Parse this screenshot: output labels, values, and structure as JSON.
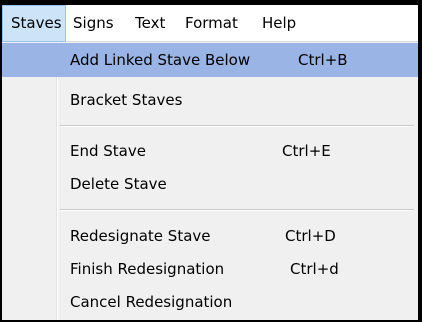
{
  "menubar": {
    "items": [
      {
        "label": "Staves",
        "active": true
      },
      {
        "label": "Signs"
      },
      {
        "label": "Text"
      },
      {
        "label": "Format"
      },
      {
        "label": "Help"
      }
    ]
  },
  "dropdown": {
    "items": [
      {
        "label": "Add Linked Stave Below",
        "shortcut": "Ctrl+B",
        "highlighted": true
      },
      {
        "label": "Bracket Staves",
        "shortcut": ""
      },
      {
        "label": "End Stave",
        "shortcut": "Ctrl+E"
      },
      {
        "label": "Delete Stave",
        "shortcut": ""
      },
      {
        "label": "Redesignate Stave",
        "shortcut": "Ctrl+D"
      },
      {
        "label": "Finish Redesignation",
        "shortcut": "Ctrl+d"
      },
      {
        "label": "Cancel Redesignation",
        "shortcut": ""
      }
    ]
  },
  "colors": {
    "active_menu_bg": "#cde3f8",
    "highlight_bg": "#99b4e5",
    "dropdown_bg": "#f0f0f0"
  }
}
